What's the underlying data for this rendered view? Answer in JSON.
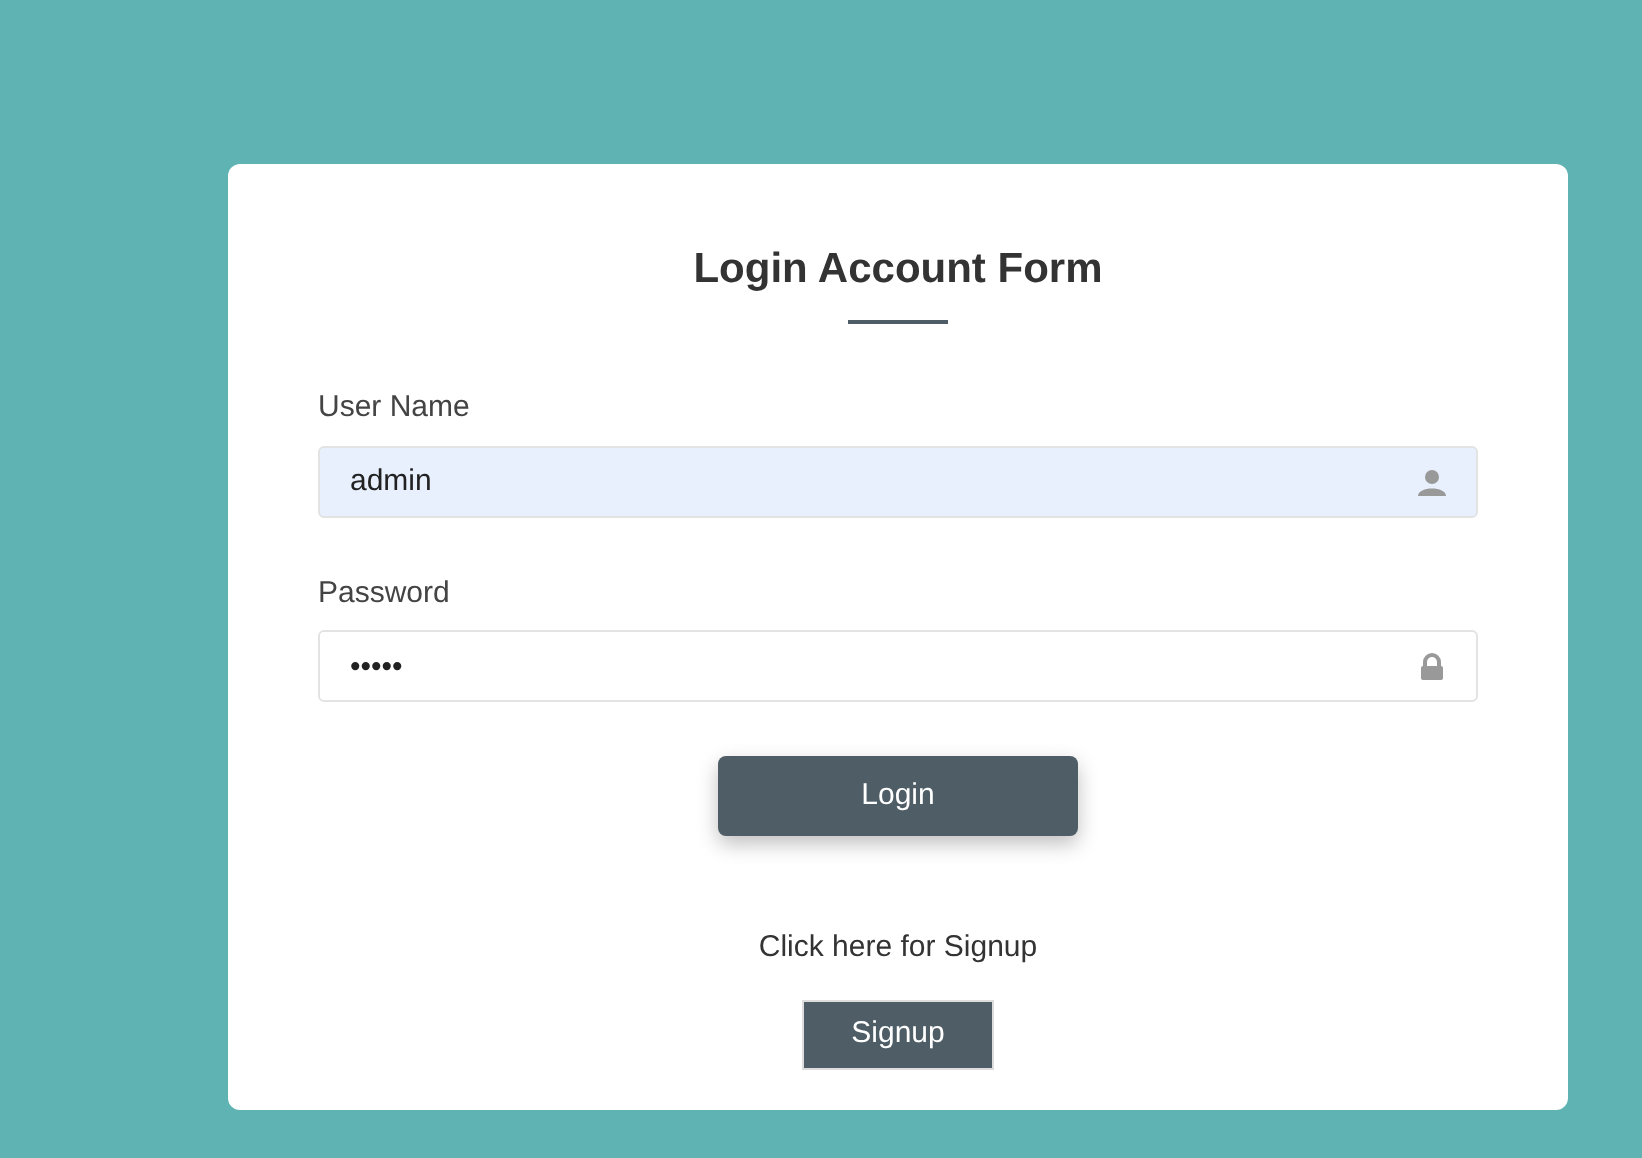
{
  "title": "Login Account Form",
  "fields": [
    {
      "label": "User Name",
      "value": "admin",
      "kind": "user",
      "autofilled": true
    },
    {
      "label": "Password",
      "value": "•••••",
      "kind": "lock",
      "autofilled": false
    }
  ],
  "login_button": "Login",
  "signup_prompt": "Click here for Signup",
  "signup_button": "Signup"
}
